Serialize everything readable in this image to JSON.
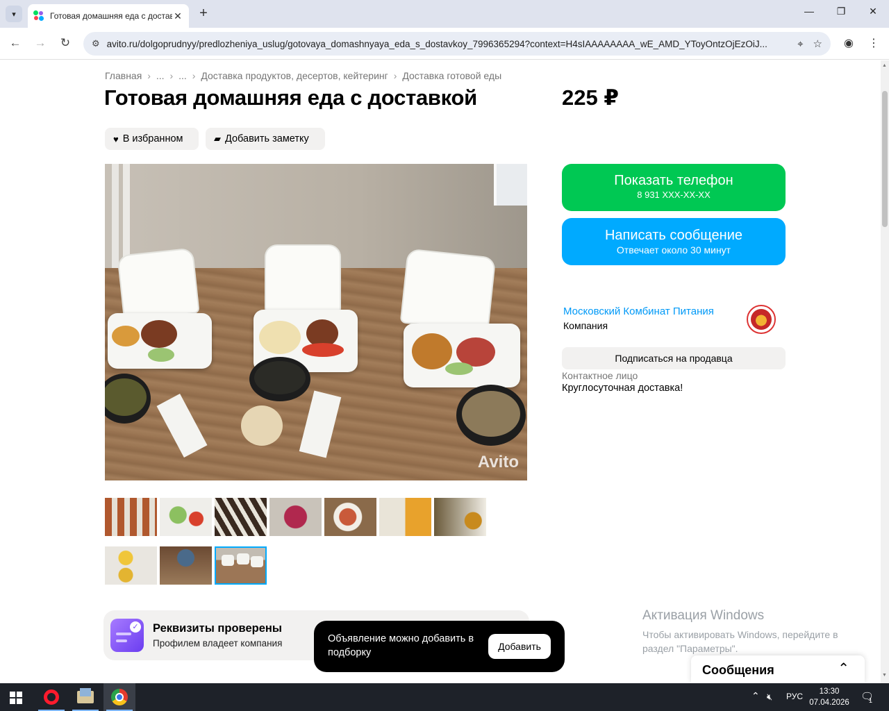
{
  "browser": {
    "tab_title": "Готовая домашняя еда с доставкой",
    "url": "avito.ru/dolgoprudnyy/predlozheniya_uslug/gotovaya_domashnyaya_eda_s_dostavkoy_7996365294?context=H4sIAAAAAAAA_wE_AMD_YToyOntzOjEzOiJ..."
  },
  "breadcrumb": [
    "Главная",
    "...",
    "...",
    "Доставка продуктов, десертов, кейтеринг",
    "Доставка готовой еды"
  ],
  "listing": {
    "title": "Готовая домашняя еда с доставкой",
    "price": "225 ₽",
    "favorite_label": "В избранном",
    "note_label": "Добавить заметку",
    "watermark": "Avito",
    "thumbnail_count": 10,
    "selected_thumbnail": 10
  },
  "actions": {
    "phone_label": "Показать телефон",
    "phone_number": "8 931 XXX-XX-XX",
    "message_label": "Написать сообщение",
    "message_sub": "Отвечает около 30 минут"
  },
  "seller": {
    "name": "Московский Комбинат Питания",
    "type": "Компания",
    "subscribe_label": "Подписаться на продавца",
    "contact_label": "Контактное лицо",
    "contact_value": "Круглосуточная доставка!"
  },
  "verified": {
    "title": "Реквизиты проверены",
    "subtitle": "Профилем владеет компания"
  },
  "toast": {
    "text": "Объявление можно добавить в подборку",
    "button": "Добавить"
  },
  "activation": {
    "title": "Активация Windows",
    "text": "Чтобы активировать Windows, перейдите в раздел \"Параметры\"."
  },
  "messages_widget": {
    "title": "Сообщения"
  },
  "taskbar": {
    "language": "РУС",
    "time": "13:30",
    "date": "07.04.2026",
    "notification_count": "1"
  },
  "colors": {
    "phone_button": "#00c853",
    "message_button": "#00aaff",
    "link": "#0099f7"
  }
}
